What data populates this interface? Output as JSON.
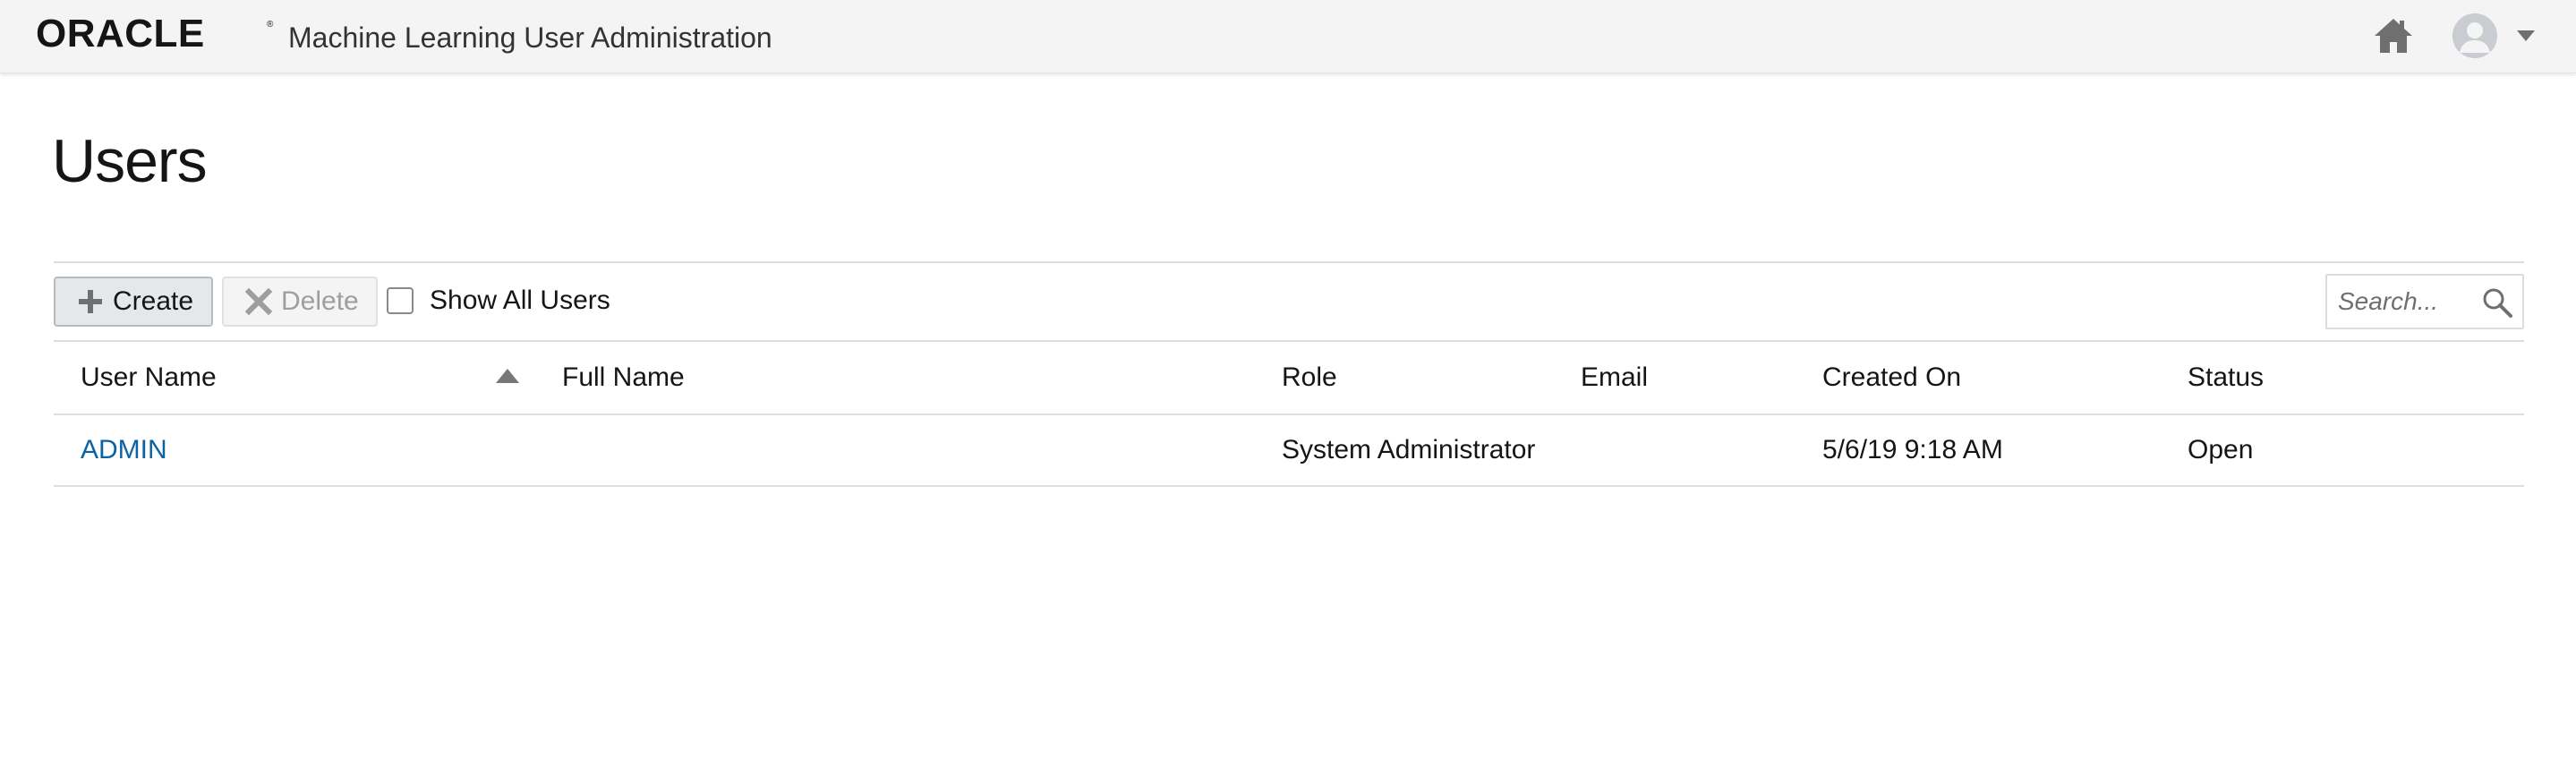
{
  "header": {
    "logo_text": "ORACLE",
    "app_title": "Machine Learning User Administration",
    "home_icon": "home-icon",
    "user_icon": "user-avatar-icon"
  },
  "page": {
    "title": "Users"
  },
  "toolbar": {
    "create_label": "Create",
    "delete_label": "Delete",
    "show_all_label": "Show All Users",
    "show_all_checked": false
  },
  "search": {
    "placeholder": "Search...",
    "value": ""
  },
  "table": {
    "columns": {
      "user_name": "User Name",
      "full_name": "Full Name",
      "role": "Role",
      "email": "Email",
      "created_on": "Created On",
      "status": "Status"
    },
    "sort": {
      "column": "User Name",
      "direction": "ascending"
    },
    "rows": [
      {
        "user_name": "ADMIN",
        "full_name": "",
        "role": "System Administrator",
        "email": "",
        "created_on": "5/6/19 9:18 AM",
        "status": "Open"
      }
    ]
  },
  "colors": {
    "brand": "#c74634",
    "link": "#0b63a3",
    "header_bg": "#f4f4f4"
  }
}
